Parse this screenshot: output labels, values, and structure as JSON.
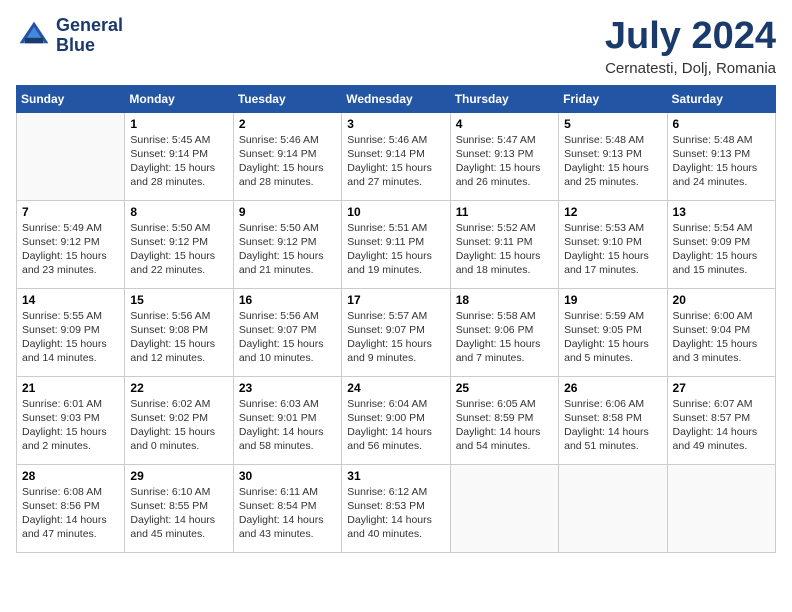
{
  "header": {
    "logo_line1": "General",
    "logo_line2": "Blue",
    "month_year": "July 2024",
    "location": "Cernatesti, Dolj, Romania"
  },
  "weekdays": [
    "Sunday",
    "Monday",
    "Tuesday",
    "Wednesday",
    "Thursday",
    "Friday",
    "Saturday"
  ],
  "weeks": [
    [
      {
        "day": "",
        "info": ""
      },
      {
        "day": "1",
        "info": "Sunrise: 5:45 AM\nSunset: 9:14 PM\nDaylight: 15 hours\nand 28 minutes."
      },
      {
        "day": "2",
        "info": "Sunrise: 5:46 AM\nSunset: 9:14 PM\nDaylight: 15 hours\nand 28 minutes."
      },
      {
        "day": "3",
        "info": "Sunrise: 5:46 AM\nSunset: 9:14 PM\nDaylight: 15 hours\nand 27 minutes."
      },
      {
        "day": "4",
        "info": "Sunrise: 5:47 AM\nSunset: 9:13 PM\nDaylight: 15 hours\nand 26 minutes."
      },
      {
        "day": "5",
        "info": "Sunrise: 5:48 AM\nSunset: 9:13 PM\nDaylight: 15 hours\nand 25 minutes."
      },
      {
        "day": "6",
        "info": "Sunrise: 5:48 AM\nSunset: 9:13 PM\nDaylight: 15 hours\nand 24 minutes."
      }
    ],
    [
      {
        "day": "7",
        "info": "Sunrise: 5:49 AM\nSunset: 9:12 PM\nDaylight: 15 hours\nand 23 minutes."
      },
      {
        "day": "8",
        "info": "Sunrise: 5:50 AM\nSunset: 9:12 PM\nDaylight: 15 hours\nand 22 minutes."
      },
      {
        "day": "9",
        "info": "Sunrise: 5:50 AM\nSunset: 9:12 PM\nDaylight: 15 hours\nand 21 minutes."
      },
      {
        "day": "10",
        "info": "Sunrise: 5:51 AM\nSunset: 9:11 PM\nDaylight: 15 hours\nand 19 minutes."
      },
      {
        "day": "11",
        "info": "Sunrise: 5:52 AM\nSunset: 9:11 PM\nDaylight: 15 hours\nand 18 minutes."
      },
      {
        "day": "12",
        "info": "Sunrise: 5:53 AM\nSunset: 9:10 PM\nDaylight: 15 hours\nand 17 minutes."
      },
      {
        "day": "13",
        "info": "Sunrise: 5:54 AM\nSunset: 9:09 PM\nDaylight: 15 hours\nand 15 minutes."
      }
    ],
    [
      {
        "day": "14",
        "info": "Sunrise: 5:55 AM\nSunset: 9:09 PM\nDaylight: 15 hours\nand 14 minutes."
      },
      {
        "day": "15",
        "info": "Sunrise: 5:56 AM\nSunset: 9:08 PM\nDaylight: 15 hours\nand 12 minutes."
      },
      {
        "day": "16",
        "info": "Sunrise: 5:56 AM\nSunset: 9:07 PM\nDaylight: 15 hours\nand 10 minutes."
      },
      {
        "day": "17",
        "info": "Sunrise: 5:57 AM\nSunset: 9:07 PM\nDaylight: 15 hours\nand 9 minutes."
      },
      {
        "day": "18",
        "info": "Sunrise: 5:58 AM\nSunset: 9:06 PM\nDaylight: 15 hours\nand 7 minutes."
      },
      {
        "day": "19",
        "info": "Sunrise: 5:59 AM\nSunset: 9:05 PM\nDaylight: 15 hours\nand 5 minutes."
      },
      {
        "day": "20",
        "info": "Sunrise: 6:00 AM\nSunset: 9:04 PM\nDaylight: 15 hours\nand 3 minutes."
      }
    ],
    [
      {
        "day": "21",
        "info": "Sunrise: 6:01 AM\nSunset: 9:03 PM\nDaylight: 15 hours\nand 2 minutes."
      },
      {
        "day": "22",
        "info": "Sunrise: 6:02 AM\nSunset: 9:02 PM\nDaylight: 15 hours\nand 0 minutes."
      },
      {
        "day": "23",
        "info": "Sunrise: 6:03 AM\nSunset: 9:01 PM\nDaylight: 14 hours\nand 58 minutes."
      },
      {
        "day": "24",
        "info": "Sunrise: 6:04 AM\nSunset: 9:00 PM\nDaylight: 14 hours\nand 56 minutes."
      },
      {
        "day": "25",
        "info": "Sunrise: 6:05 AM\nSunset: 8:59 PM\nDaylight: 14 hours\nand 54 minutes."
      },
      {
        "day": "26",
        "info": "Sunrise: 6:06 AM\nSunset: 8:58 PM\nDaylight: 14 hours\nand 51 minutes."
      },
      {
        "day": "27",
        "info": "Sunrise: 6:07 AM\nSunset: 8:57 PM\nDaylight: 14 hours\nand 49 minutes."
      }
    ],
    [
      {
        "day": "28",
        "info": "Sunrise: 6:08 AM\nSunset: 8:56 PM\nDaylight: 14 hours\nand 47 minutes."
      },
      {
        "day": "29",
        "info": "Sunrise: 6:10 AM\nSunset: 8:55 PM\nDaylight: 14 hours\nand 45 minutes."
      },
      {
        "day": "30",
        "info": "Sunrise: 6:11 AM\nSunset: 8:54 PM\nDaylight: 14 hours\nand 43 minutes."
      },
      {
        "day": "31",
        "info": "Sunrise: 6:12 AM\nSunset: 8:53 PM\nDaylight: 14 hours\nand 40 minutes."
      },
      {
        "day": "",
        "info": ""
      },
      {
        "day": "",
        "info": ""
      },
      {
        "day": "",
        "info": ""
      }
    ]
  ]
}
